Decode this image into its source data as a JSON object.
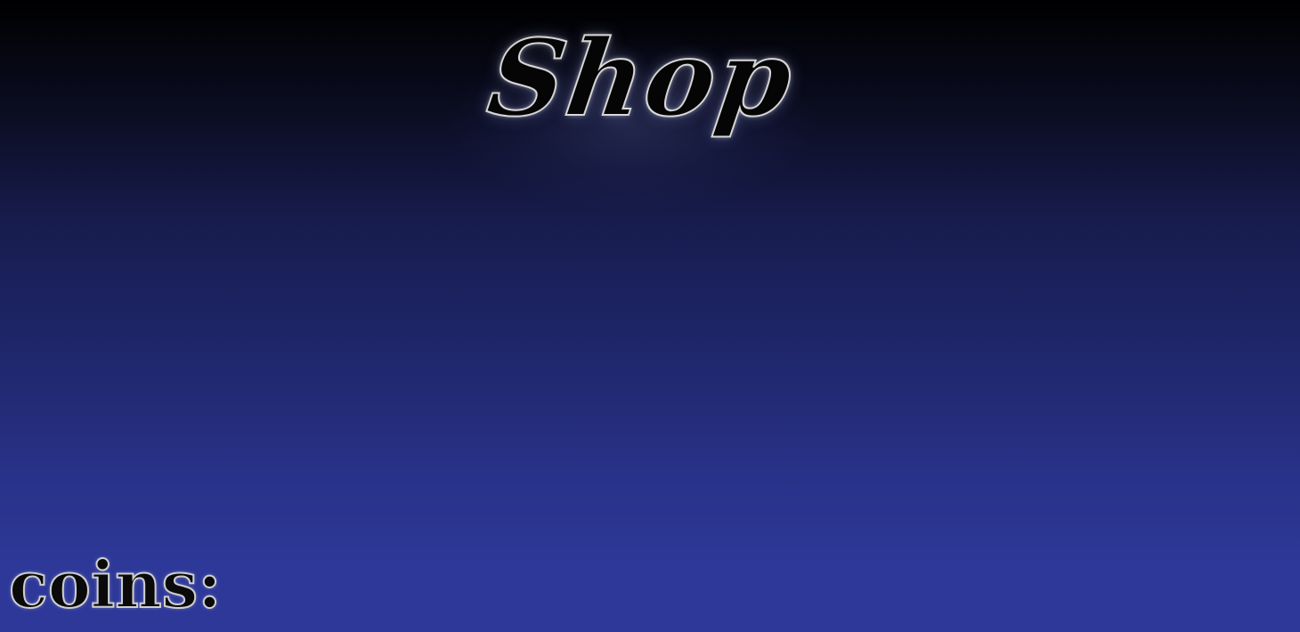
{
  "screen": {
    "title": "Shop",
    "background_top": "#000000",
    "background_bottom": "#2e3898"
  },
  "coins": {
    "label": "coins:",
    "value": ""
  }
}
